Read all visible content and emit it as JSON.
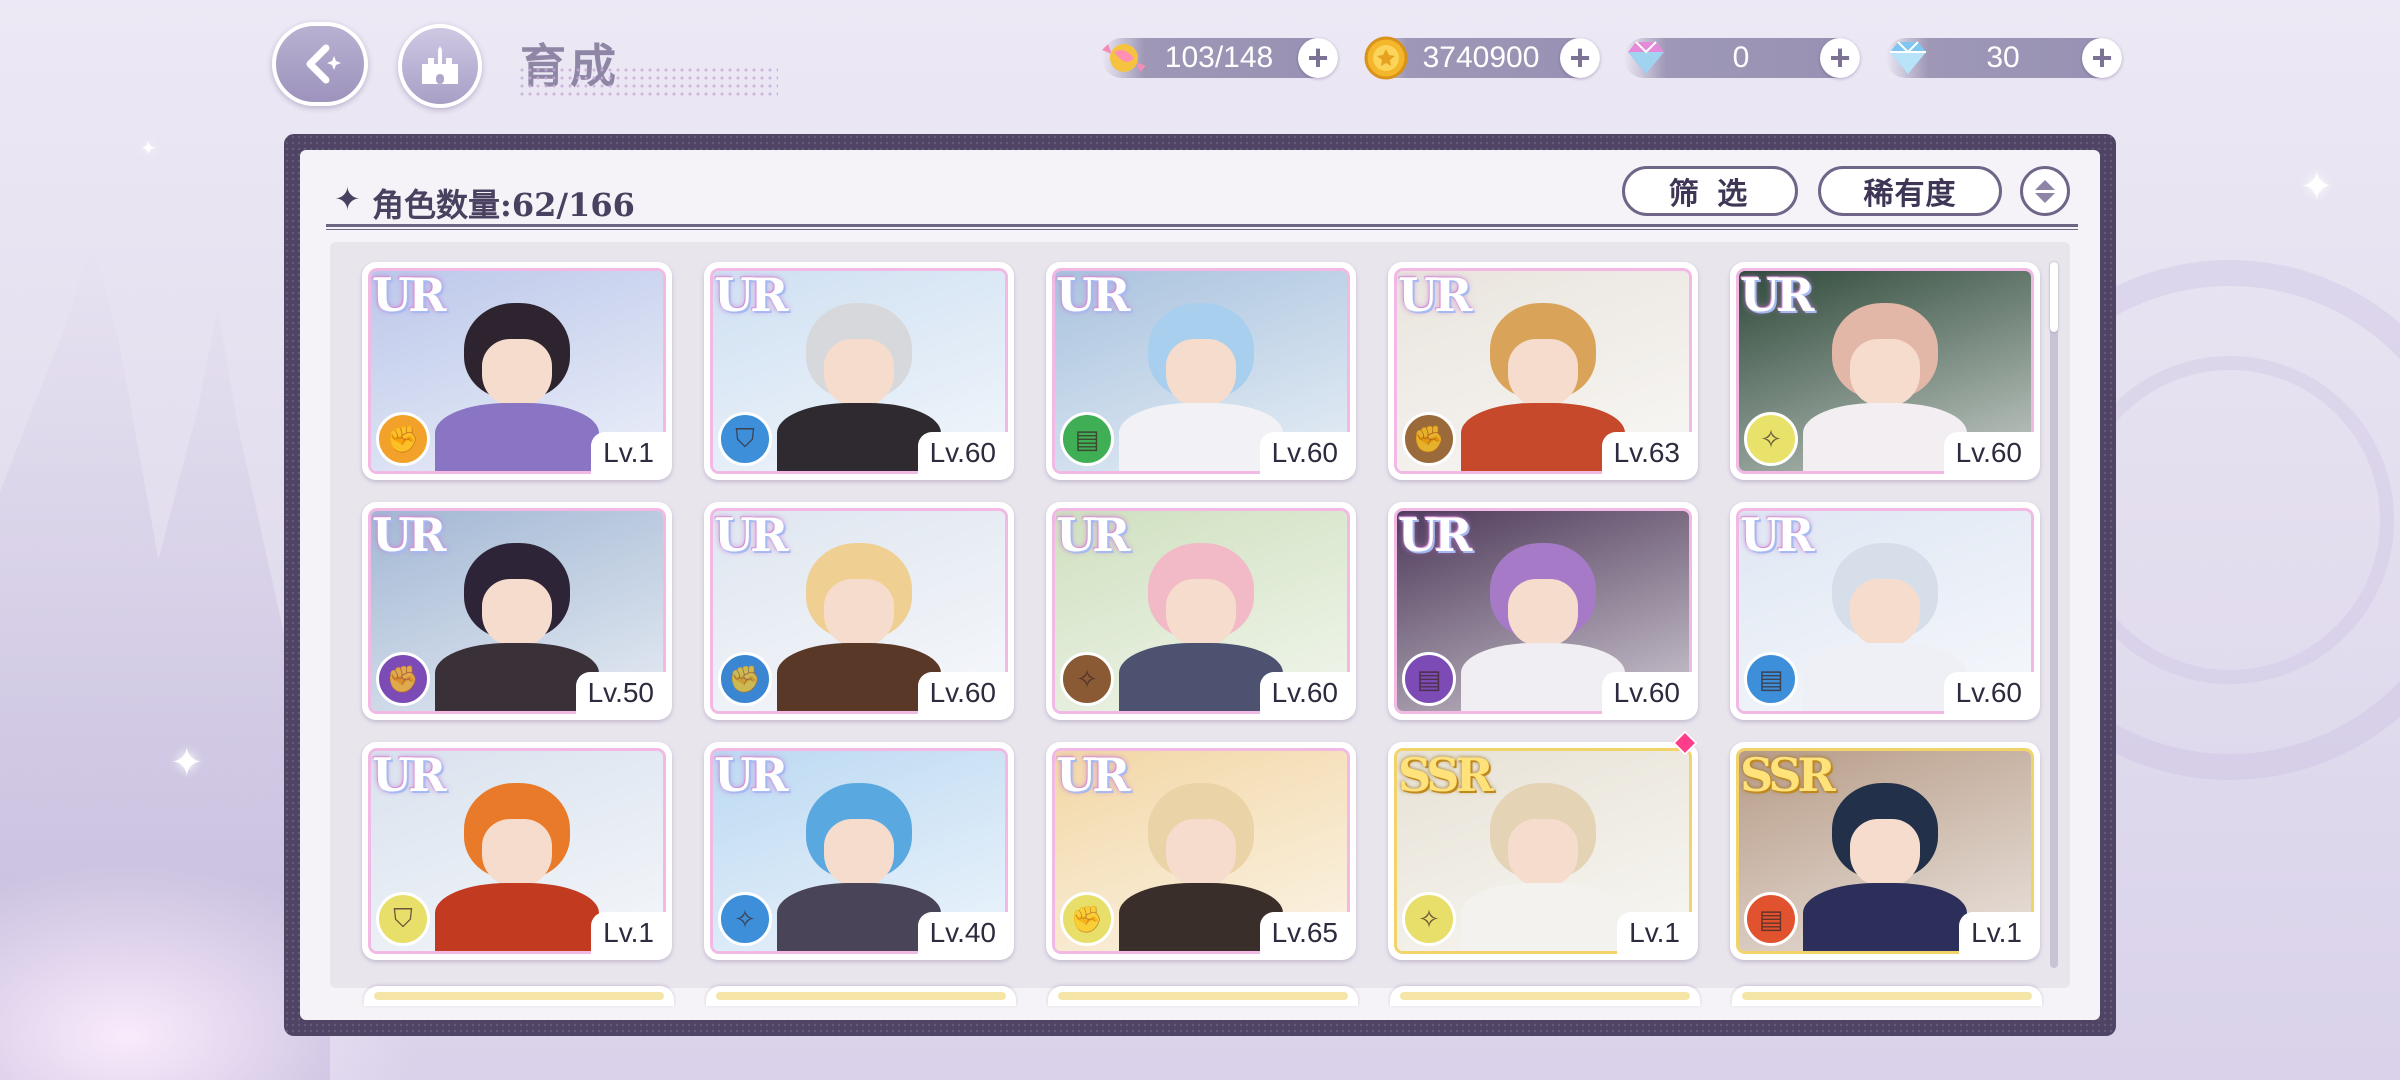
{
  "header": {
    "title": "育成",
    "currencies": [
      {
        "name": "candy",
        "value": "103/148"
      },
      {
        "name": "coin",
        "value": "3740900"
      },
      {
        "name": "pink-gem",
        "value": "0"
      },
      {
        "name": "diamond",
        "value": "30"
      }
    ]
  },
  "panel": {
    "count_label": "角色数量:",
    "count_value": "62/166",
    "filter_label": "筛 选",
    "sort_label": "稀有度"
  },
  "characters": [
    {
      "rarity": "UR",
      "level": "Lv.1",
      "attr": "fist",
      "attr_color": "#f2a22a"
    },
    {
      "rarity": "UR",
      "level": "Lv.60",
      "attr": "shield",
      "attr_color": "#3c8fd8"
    },
    {
      "rarity": "UR",
      "level": "Lv.60",
      "attr": "book",
      "attr_color": "#3fae54"
    },
    {
      "rarity": "UR",
      "level": "Lv.63",
      "attr": "fist",
      "attr_color": "#9a6a3a"
    },
    {
      "rarity": "UR",
      "level": "Lv.60",
      "attr": "wand",
      "attr_color": "#e9e26a"
    },
    {
      "rarity": "UR",
      "level": "Lv.50",
      "attr": "fist",
      "attr_color": "#7c4bb5"
    },
    {
      "rarity": "UR",
      "level": "Lv.60",
      "attr": "fist",
      "attr_color": "#3a86d2"
    },
    {
      "rarity": "UR",
      "level": "Lv.60",
      "attr": "wand",
      "attr_color": "#8a5a34"
    },
    {
      "rarity": "UR",
      "level": "Lv.60",
      "attr": "book",
      "attr_color": "#7c4bb5"
    },
    {
      "rarity": "UR",
      "level": "Lv.60",
      "attr": "book",
      "attr_color": "#3c8fd8"
    },
    {
      "rarity": "UR",
      "level": "Lv.1",
      "attr": "shield",
      "attr_color": "#e8df6a"
    },
    {
      "rarity": "UR",
      "level": "Lv.40",
      "attr": "wand",
      "attr_color": "#3c8fd8"
    },
    {
      "rarity": "UR",
      "level": "Lv.65",
      "attr": "fist",
      "attr_color": "#e8df6a"
    },
    {
      "rarity": "SSR",
      "level": "Lv.1",
      "attr": "wand",
      "attr_color": "#e8df6a"
    },
    {
      "rarity": "SSR",
      "level": "Lv.1",
      "attr": "book",
      "attr_color": "#e0532e"
    }
  ],
  "art": [
    {
      "sky": "#bcc8ea",
      "hair": "#2d2430",
      "body": "#8a74c4"
    },
    {
      "sky": "#cfe0f2",
      "hair": "#d7d8dc",
      "body": "#2e2a2f"
    },
    {
      "sky": "#a9c3de",
      "hair": "#a9cfee",
      "body": "#f2f2f6"
    },
    {
      "sky": "#e9e4dd",
      "hair": "#d9a45a",
      "body": "#c7492c"
    },
    {
      "sky": "#2f4a3a",
      "hair": "#e3b7a8",
      "body": "#f2eef1"
    },
    {
      "sky": "#a3b8d4",
      "hair": "#2e2438",
      "body": "#3a3038"
    },
    {
      "sky": "#dfe6f0",
      "hair": "#efcf92",
      "body": "#5a3828"
    },
    {
      "sky": "#cfe0bf",
      "hair": "#f2b9c6",
      "body": "#4c5270"
    },
    {
      "sky": "#4e3a5a",
      "hair": "#a77ac8",
      "body": "#f0eef2"
    },
    {
      "sky": "#dfe7f3",
      "hair": "#d6deea",
      "body": "#eef0f5"
    },
    {
      "sky": "#d9e2ee",
      "hair": "#e87a2a",
      "body": "#c23a20"
    },
    {
      "sky": "#bcd9f2",
      "hair": "#5aa8e0",
      "body": "#4a4458"
    },
    {
      "sky": "#f2d7a6",
      "hair": "#ead3a6",
      "body": "#3a2e2a"
    },
    {
      "sky": "#e7e2d6",
      "hair": "#e5d3b6",
      "body": "#f4f2ee"
    },
    {
      "sky": "#b79c88",
      "hair": "#23304a",
      "body": "#2b2f5a"
    }
  ]
}
